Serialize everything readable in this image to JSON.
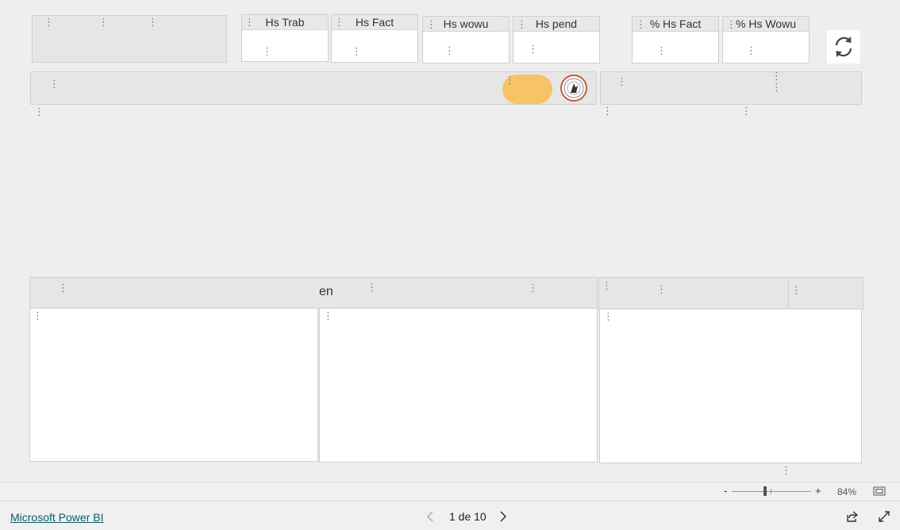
{
  "kpis": {
    "hs_trab": "Hs Trab",
    "hs_fact": "Hs Fact",
    "hs_wowu": "Hs wowu",
    "hs_pend": "Hs pend",
    "pct_hs_fact": "% Hs Fact",
    "pct_hs_wowu": "% Hs Wowu"
  },
  "bottom": {
    "header_label": "en"
  },
  "zoom": {
    "minus": "-",
    "plus": "+",
    "level": "84%"
  },
  "footer": {
    "brand_link": "Microsoft Power BI",
    "page_indicator": "1 de 10"
  },
  "icons": {
    "refresh": "refresh-icon",
    "prev": "chevron-left-icon",
    "next": "chevron-right-icon",
    "share": "share-icon",
    "fullscreen": "expand-icon",
    "fit": "fit-to-page-icon"
  },
  "colors": {
    "toggle_fill": "#f6c466",
    "logo_ring": "#c85a3c",
    "link": "#0b5c6b"
  }
}
